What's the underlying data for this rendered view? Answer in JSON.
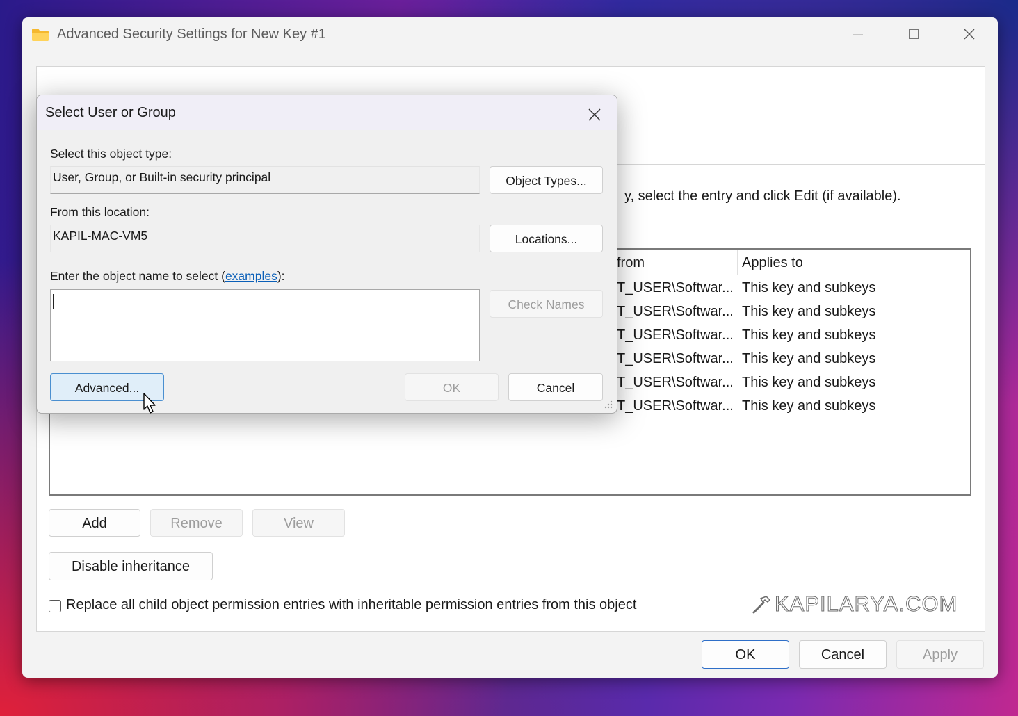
{
  "window": {
    "title": "Advanced Security Settings for New Key #1",
    "instruction_fragment": "y, select the entry and click Edit (if available).",
    "columns": {
      "from": "from",
      "applies_to": "Applies to"
    },
    "rows": [
      {
        "from": "T_USER\\Softwar...",
        "applies_to": "This key and subkeys"
      },
      {
        "from": "T_USER\\Softwar...",
        "applies_to": "This key and subkeys"
      },
      {
        "from": "T_USER\\Softwar...",
        "applies_to": "This key and subkeys"
      },
      {
        "from": "T_USER\\Softwar...",
        "applies_to": "This key and subkeys"
      },
      {
        "from": "T_USER\\Softwar...",
        "applies_to": "This key and subkeys"
      },
      {
        "from": "T_USER\\Softwar...",
        "applies_to": "This key and subkeys"
      }
    ],
    "buttons": {
      "add": "Add",
      "remove": "Remove",
      "view": "View",
      "disable_inheritance": "Disable inheritance",
      "ok": "OK",
      "cancel": "Cancel",
      "apply": "Apply"
    },
    "replace_checkbox_label": "Replace all child object permission entries with inheritable permission entries from this object",
    "replace_checked": false
  },
  "dialog": {
    "title": "Select User or Group",
    "object_type_label": "Select this object type:",
    "object_type_value": "User, Group, or Built-in security principal",
    "location_label": "From this location:",
    "location_value": "KAPIL-MAC-VM5",
    "object_name_label_prefix": "Enter the object name to select (",
    "object_name_label_link": "examples",
    "object_name_label_suffix": "):",
    "object_name_value": "",
    "buttons": {
      "object_types": "Object Types...",
      "locations": "Locations...",
      "check_names": "Check Names",
      "advanced": "Advanced...",
      "ok": "OK",
      "cancel": "Cancel"
    }
  },
  "watermark": "KAPILARYA.COM",
  "icons": [
    "folder-icon",
    "minimize-icon",
    "maximize-icon",
    "close-icon",
    "dialog-close-icon",
    "mouse-cursor-icon",
    "resize-grip-icon",
    "hammer-icon"
  ],
  "colors": {
    "accent": "#2f6fc8",
    "link": "#0a5fb8",
    "advanced_button_bg": "#e0eef9"
  }
}
